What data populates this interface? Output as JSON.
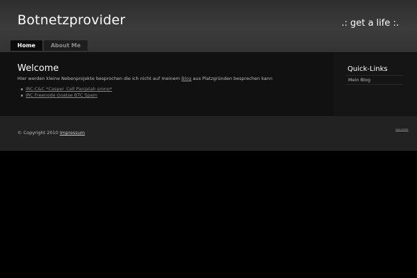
{
  "header": {
    "title": "Botnetzprovider",
    "tagline": ".: get a life :."
  },
  "nav": {
    "tabs": [
      {
        "label": "Home",
        "active": true
      },
      {
        "label": "About Me",
        "active": false
      }
    ]
  },
  "main": {
    "heading": "Welcome",
    "intro_before": "Hier werden kleine Nebenprojekte besprochen die ich nicht auf meinem ",
    "intro_link": "Blog",
    "intro_after": " aus Platzgründen besprechen kann",
    "links": [
      "IRC-C&C *Casper_Cell Panjatah srono*",
      "IRC Freenode Goatse BTC Spam"
    ]
  },
  "sidebar": {
    "title": "Quick-Links",
    "items": [
      "Mein Blog"
    ]
  },
  "footer": {
    "copyright": "© Copyright 2010",
    "impressum": "Impressum",
    "badge": "Valid XHTML"
  },
  "colors": {
    "background": "#000000",
    "header": "#3a3a3a",
    "content": "#111111",
    "footer": "#222222",
    "text": "#ffffff"
  }
}
